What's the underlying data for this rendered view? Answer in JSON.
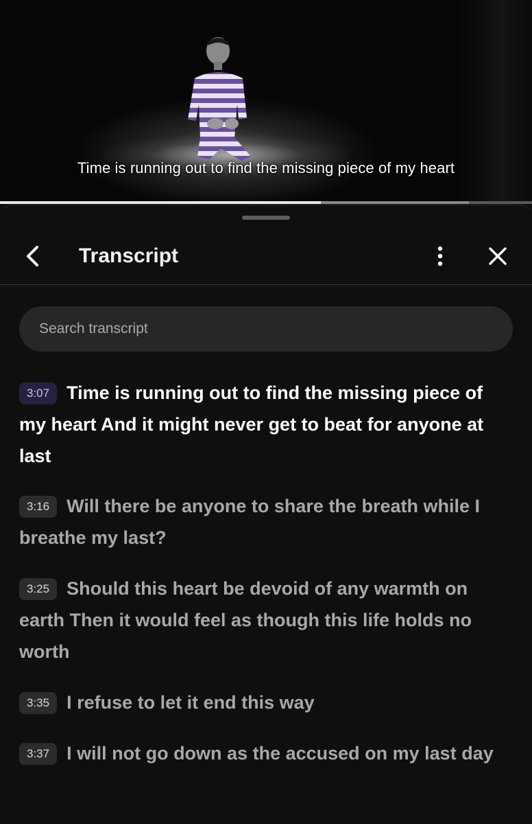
{
  "player": {
    "caption": "Time is running out to find the missing piece of my heart",
    "progress_played": 0.603,
    "progress_buffered": 0.882
  },
  "panel": {
    "title": "Transcript",
    "icons": {
      "back": "chevron-left-icon",
      "more": "more-vert-icon",
      "close": "close-icon"
    }
  },
  "search": {
    "placeholder": "Search transcript",
    "value": ""
  },
  "segments": [
    {
      "time": "3:07",
      "text": "Time is running out to find the missing piece of my heart And it might never get to beat for anyone at last",
      "active": true
    },
    {
      "time": "3:16",
      "text": "Will there be anyone to share the breath while I breathe my last?",
      "active": false
    },
    {
      "time": "3:25",
      "text": "Should this heart be devoid of any warmth on earth Then it would feel as though this life holds no worth",
      "active": false
    },
    {
      "time": "3:35",
      "text": "I refuse to let it end this way",
      "active": false
    },
    {
      "time": "3:37",
      "text": "I will not go down as the accused on my last day",
      "active": false
    }
  ],
  "colors": {
    "background": "#0f0f0f",
    "active_text": "#ffffff",
    "inactive_text": "#a8a8a8",
    "active_timestamp_bg": "#27213f",
    "timestamp_bg": "#2c2c2c"
  }
}
